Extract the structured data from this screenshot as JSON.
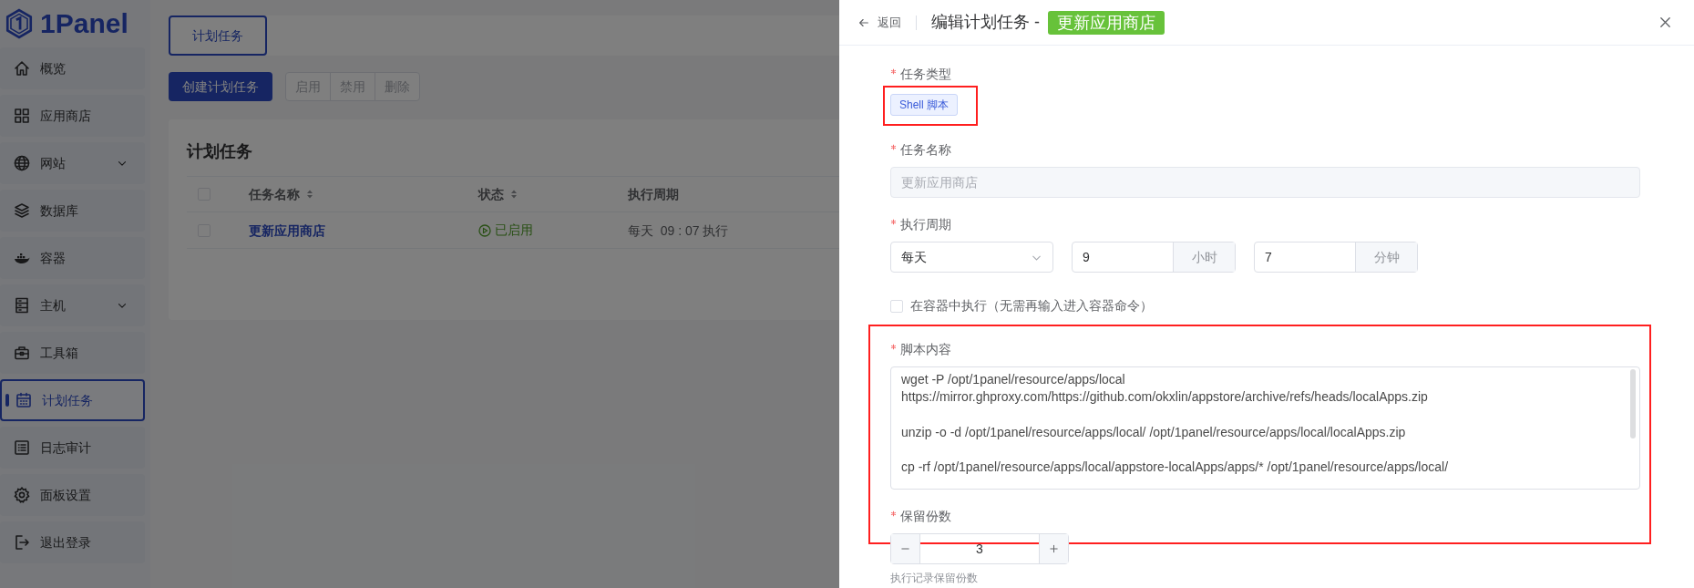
{
  "sidebar": {
    "logo": "1Panel",
    "items": [
      {
        "label": "概览",
        "selected": false,
        "expandable": false
      },
      {
        "label": "应用商店",
        "selected": false,
        "expandable": false
      },
      {
        "label": "网站",
        "selected": false,
        "expandable": true
      },
      {
        "label": "数据库",
        "selected": false,
        "expandable": false
      },
      {
        "label": "容器",
        "selected": false,
        "expandable": false
      },
      {
        "label": "主机",
        "selected": false,
        "expandable": true
      },
      {
        "label": "工具箱",
        "selected": false,
        "expandable": false
      },
      {
        "label": "计划任务",
        "selected": true,
        "expandable": false
      },
      {
        "label": "日志审计",
        "selected": false,
        "expandable": false
      },
      {
        "label": "面板设置",
        "selected": false,
        "expandable": false
      },
      {
        "label": "退出登录",
        "selected": false,
        "expandable": false
      }
    ]
  },
  "page_tabs": [
    {
      "label": "计划任务",
      "selected": true
    }
  ],
  "toolbar": {
    "create_button": "创建计划任务",
    "batch_buttons": [
      {
        "label": "启用",
        "disabled": true
      },
      {
        "label": "禁用",
        "disabled": true
      },
      {
        "label": "删除",
        "disabled": true
      }
    ]
  },
  "card": {
    "title": "计划任务",
    "table": {
      "header_checked": false,
      "columns": [
        {
          "label": "任务名称",
          "sortable": true
        },
        {
          "label": "状态",
          "sortable": true
        },
        {
          "label": "执行周期",
          "sortable": false
        }
      ],
      "rows": [
        {
          "checked": false,
          "name": "更新应用商店",
          "status": "已启用",
          "enabled": true,
          "schedule": "每天  09 : 07 执行"
        }
      ]
    }
  },
  "drawer": {
    "back": "返回",
    "title": "编辑计划任务 -",
    "title_tag": "更新应用商店",
    "fields": [
      {
        "kind": "tag",
        "label": "任务类型",
        "required": true,
        "highlighted": true,
        "value": "Shell 脚本"
      },
      {
        "kind": "input",
        "label": "任务名称",
        "required": true,
        "highlighted": false,
        "value": "更新应用商店",
        "disabled": true
      },
      {
        "kind": "schedule",
        "label": "执行周期",
        "required": true,
        "highlighted": false,
        "period": "每天",
        "hour": "9",
        "hour_unit": "小时",
        "minute": "7",
        "minute_unit": "分钟"
      },
      {
        "kind": "checkbox",
        "label": "在容器中执行（无需再输入进入容器命令）",
        "checked": false
      },
      {
        "kind": "script",
        "label": "脚本内容",
        "required": true,
        "highlighted": true,
        "commands": [
          "wget -P /opt/1panel/resource/apps/local https://mirror.ghproxy.com/https://github.com/okxlin/appstore/archive/refs/heads/localApps.zip",
          "unzip -o -d /opt/1panel/resource/apps/local/ /opt/1panel/resource/apps/local/localApps.zip",
          "cp -rf /opt/1panel/resource/apps/local/appstore-localApps/apps/* /opt/1panel/resource/apps/local/"
        ]
      },
      {
        "kind": "number",
        "label": "保留份数",
        "required": true,
        "highlighted": false,
        "value": "3",
        "hint": "执行记录保留份数"
      }
    ]
  }
}
